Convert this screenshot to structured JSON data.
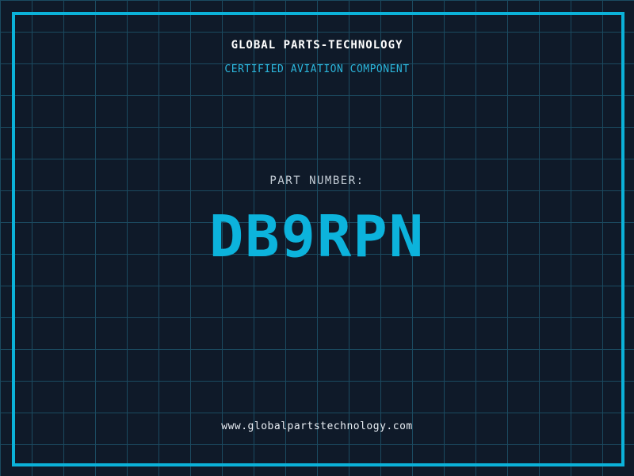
{
  "theme": {
    "background_color": "#0f1a29",
    "grid_color": "#1b4a60",
    "frame_color": "#0bb2d9",
    "title_color": "#ffffff",
    "subtitle_color": "#2bb5db",
    "label_color": "#c3ccd5",
    "part_number_color": "#0cb3dc",
    "url_color": "#e9eef4"
  },
  "header": {
    "title": "GLOBAL PARTS-TECHNOLOGY",
    "subtitle": "CERTIFIED AVIATION COMPONENT"
  },
  "part": {
    "label": "PART NUMBER:",
    "value": "DB9RPN"
  },
  "footer": {
    "url": "www.globalpartstechnology.com"
  }
}
